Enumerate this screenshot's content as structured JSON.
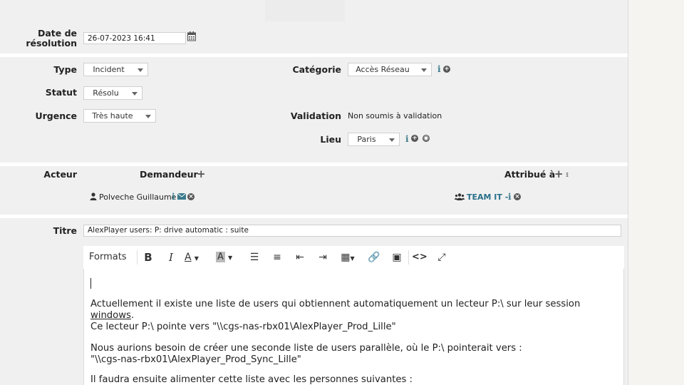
{
  "labels": {
    "date_resolution": "Date de\nrésolution",
    "type": "Type",
    "statut": "Statut",
    "urgence": "Urgence",
    "categorie": "Catégorie",
    "validation": "Validation",
    "lieu": "Lieu",
    "acteur": "Acteur",
    "demandeur": "Demandeur",
    "attribue": "Attribué à",
    "titre": "Titre"
  },
  "fields": {
    "date_resolution": "26-07-2023 16:41",
    "type": "Incident",
    "statut": "Résolu",
    "urgence": "Très haute",
    "categorie": "Accès Réseau",
    "validation": "Non soumis à validation",
    "lieu": "Paris",
    "titre": "AlexPlayer users: P: drive automatic : suite"
  },
  "actors": {
    "demandeur_name": "Polveche Guillaume",
    "attribue_name": "TEAM IT -"
  },
  "toolbar": {
    "formats": "Formats"
  },
  "editor": {
    "p1_a": "Actuellement il existe une liste de users qui obtiennent automatiquement un lecteur P:\\ sur leur session",
    "p1_b": "windows",
    "p1_c": ".",
    "p2": "Ce lecteur P:\\ pointe vers \"\\\\cgs-nas-rbx01\\AlexPlayer_Prod_Lille\"",
    "p3_a": "Nous aurions besoin de créer une seconde liste de users parallèle, où le P:\\ pointerait vers :",
    "p3_b": "\"\\\\cgs-nas-rbx01\\AlexPlayer_Prod_Sync_Lille\"",
    "p4": "Il faudra ensuite alimenter cette liste avec les personnes suivantes :"
  },
  "icons": [
    "calendar-icon",
    "chevron-down-icon",
    "info-icon",
    "plus-circle-icon",
    "globe-icon",
    "plus-icon",
    "user-icon",
    "envelope-icon",
    "close-circle-icon",
    "users-icon",
    "bold-icon",
    "italic-icon",
    "text-color-icon",
    "background-color-icon",
    "bullet-list-icon",
    "numbered-list-icon",
    "outdent-icon",
    "indent-icon",
    "table-icon",
    "link-icon",
    "image-icon",
    "code-icon",
    "fullscreen-icon"
  ],
  "colors": {
    "accent": "#2a6f8a",
    "panel": "#f0f0f0"
  }
}
